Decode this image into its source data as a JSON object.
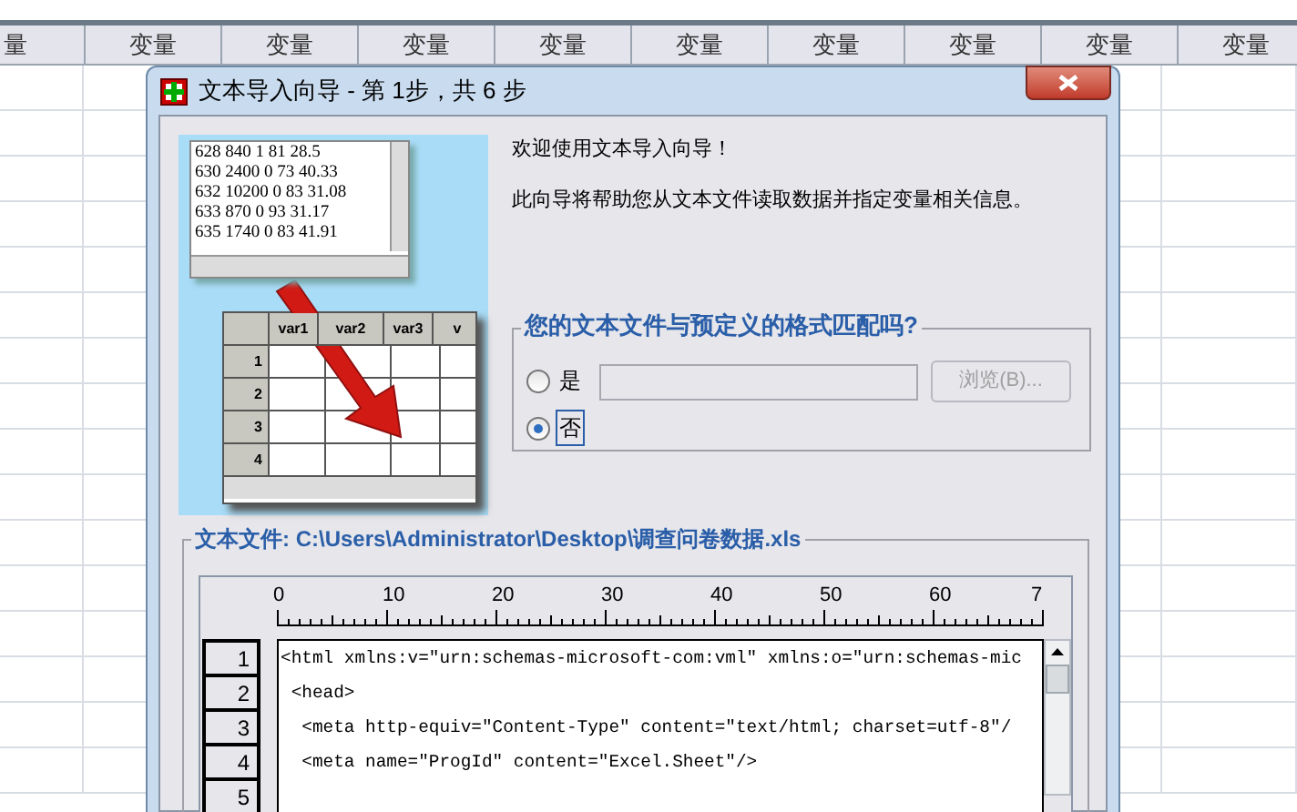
{
  "spreadsheet": {
    "column_headers": [
      "量",
      "变量",
      "变量",
      "变量",
      "变量",
      "变量",
      "变量",
      "变量",
      "变量",
      "变量"
    ]
  },
  "dialog": {
    "title": "文本导入向导 - 第 1步，共 6 步",
    "illustration": {
      "text_lines": [
        "628 840 1 81 28.5",
        "630 2400 0 73 40.33",
        "632 10200 0 83 31.08",
        "633 870 0 93 31.17",
        "635 1740 0 83 41.91"
      ],
      "grid_columns": [
        "var1",
        "var2",
        "var3",
        "v"
      ],
      "grid_rows": [
        "1",
        "2",
        "3",
        "4"
      ]
    },
    "welcome": "欢迎使用文本导入向导！",
    "description": "此向导将帮助您从文本文件读取数据并指定变量相关信息。",
    "format_group": {
      "legend": "您的文本文件与预定义的格式匹配吗?",
      "options": [
        {
          "label": "是",
          "selected": false
        },
        {
          "label": "否",
          "selected": true
        }
      ],
      "browse_button": {
        "label": "浏览(B)...",
        "disabled": true
      }
    },
    "file_group": {
      "legend": "文本文件: C:\\Users\\Administrator\\Desktop\\调查问卷数据.xls",
      "ruler_labels": [
        "0",
        "10",
        "20",
        "30",
        "40",
        "50",
        "60",
        "7"
      ],
      "lines": [
        {
          "number": "1",
          "text": "<html xmlns:v=\"urn:schemas-microsoft-com:vml\" xmlns:o=\"urn:schemas-mic"
        },
        {
          "number": "2",
          "text": " <head>"
        },
        {
          "number": "3",
          "text": "  <meta http-equiv=\"Content-Type\" content=\"text/html; charset=utf-8\"/"
        },
        {
          "number": "4",
          "text": "  <meta name=\"ProgId\" content=\"Excel.Sheet\"/>"
        },
        {
          "number": "5"
        }
      ]
    }
  }
}
